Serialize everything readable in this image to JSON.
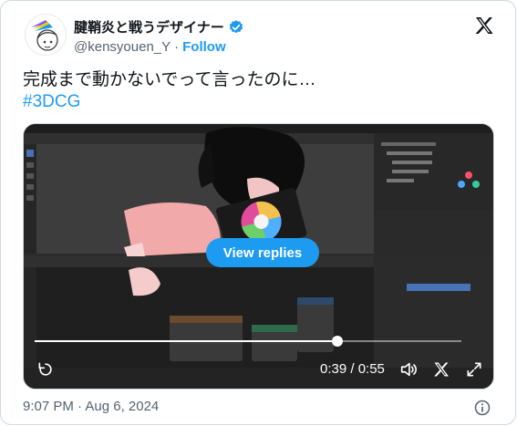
{
  "author": {
    "display_name": "腱鞘炎と戦うデザイナー",
    "handle": "@kensyouen_Y",
    "separator": "·",
    "follow_label": "Follow"
  },
  "tweet": {
    "text": "完成まで動かないでって言ったのに…",
    "hashtag": "#3DCG"
  },
  "media": {
    "view_replies_label": "View replies",
    "time": "0:39 / 0:55",
    "progress": 0.71
  },
  "footer": {
    "timestamp": "9:07 PM · Aug 6, 2024"
  },
  "colors": {
    "accent": "#1d9bf0",
    "text": "#0f1419",
    "muted": "#536471",
    "border": "#cfd9de"
  },
  "icons": [
    "x-logo-icon",
    "verified-badge-icon",
    "replay-icon",
    "volume-icon",
    "x-watermark-icon",
    "fullscreen-icon",
    "info-icon"
  ]
}
